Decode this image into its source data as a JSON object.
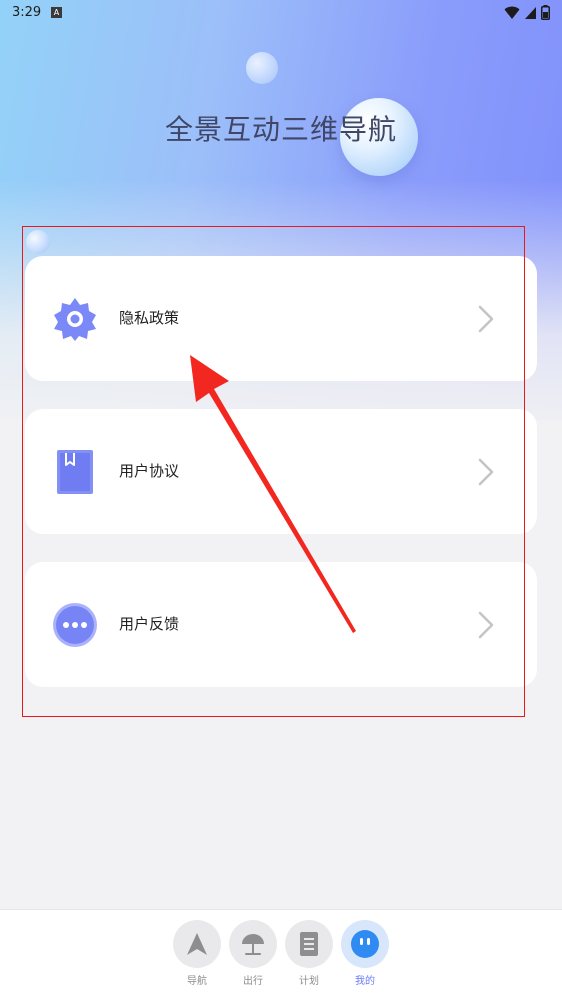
{
  "status_bar": {
    "time": "3:29",
    "notification_badge": "A",
    "icons": [
      "wifi-icon",
      "signal-icon",
      "battery-icon"
    ]
  },
  "app": {
    "title": "全景互动三维导航"
  },
  "menu": {
    "items": [
      {
        "label": "隐私政策",
        "icon": "privacy-gear-icon"
      },
      {
        "label": "用户协议",
        "icon": "agreement-book-icon"
      },
      {
        "label": "用户反馈",
        "icon": "feedback-dots-icon"
      }
    ]
  },
  "bottom_nav": {
    "items": [
      {
        "label": "导航",
        "icon": "navigation-arrow-icon",
        "active": false
      },
      {
        "label": "出行",
        "icon": "beach-umbrella-icon",
        "active": false
      },
      {
        "label": "计划",
        "icon": "plan-list-icon",
        "active": false
      },
      {
        "label": "我的",
        "icon": "profile-face-icon",
        "active": true
      }
    ]
  },
  "colors": {
    "accent": "#6a7bf5",
    "icon_fill": "#7b88f7",
    "annotation": "#e8191a",
    "hero_start": "#93d2f8",
    "hero_end": "#7f8ffb"
  }
}
